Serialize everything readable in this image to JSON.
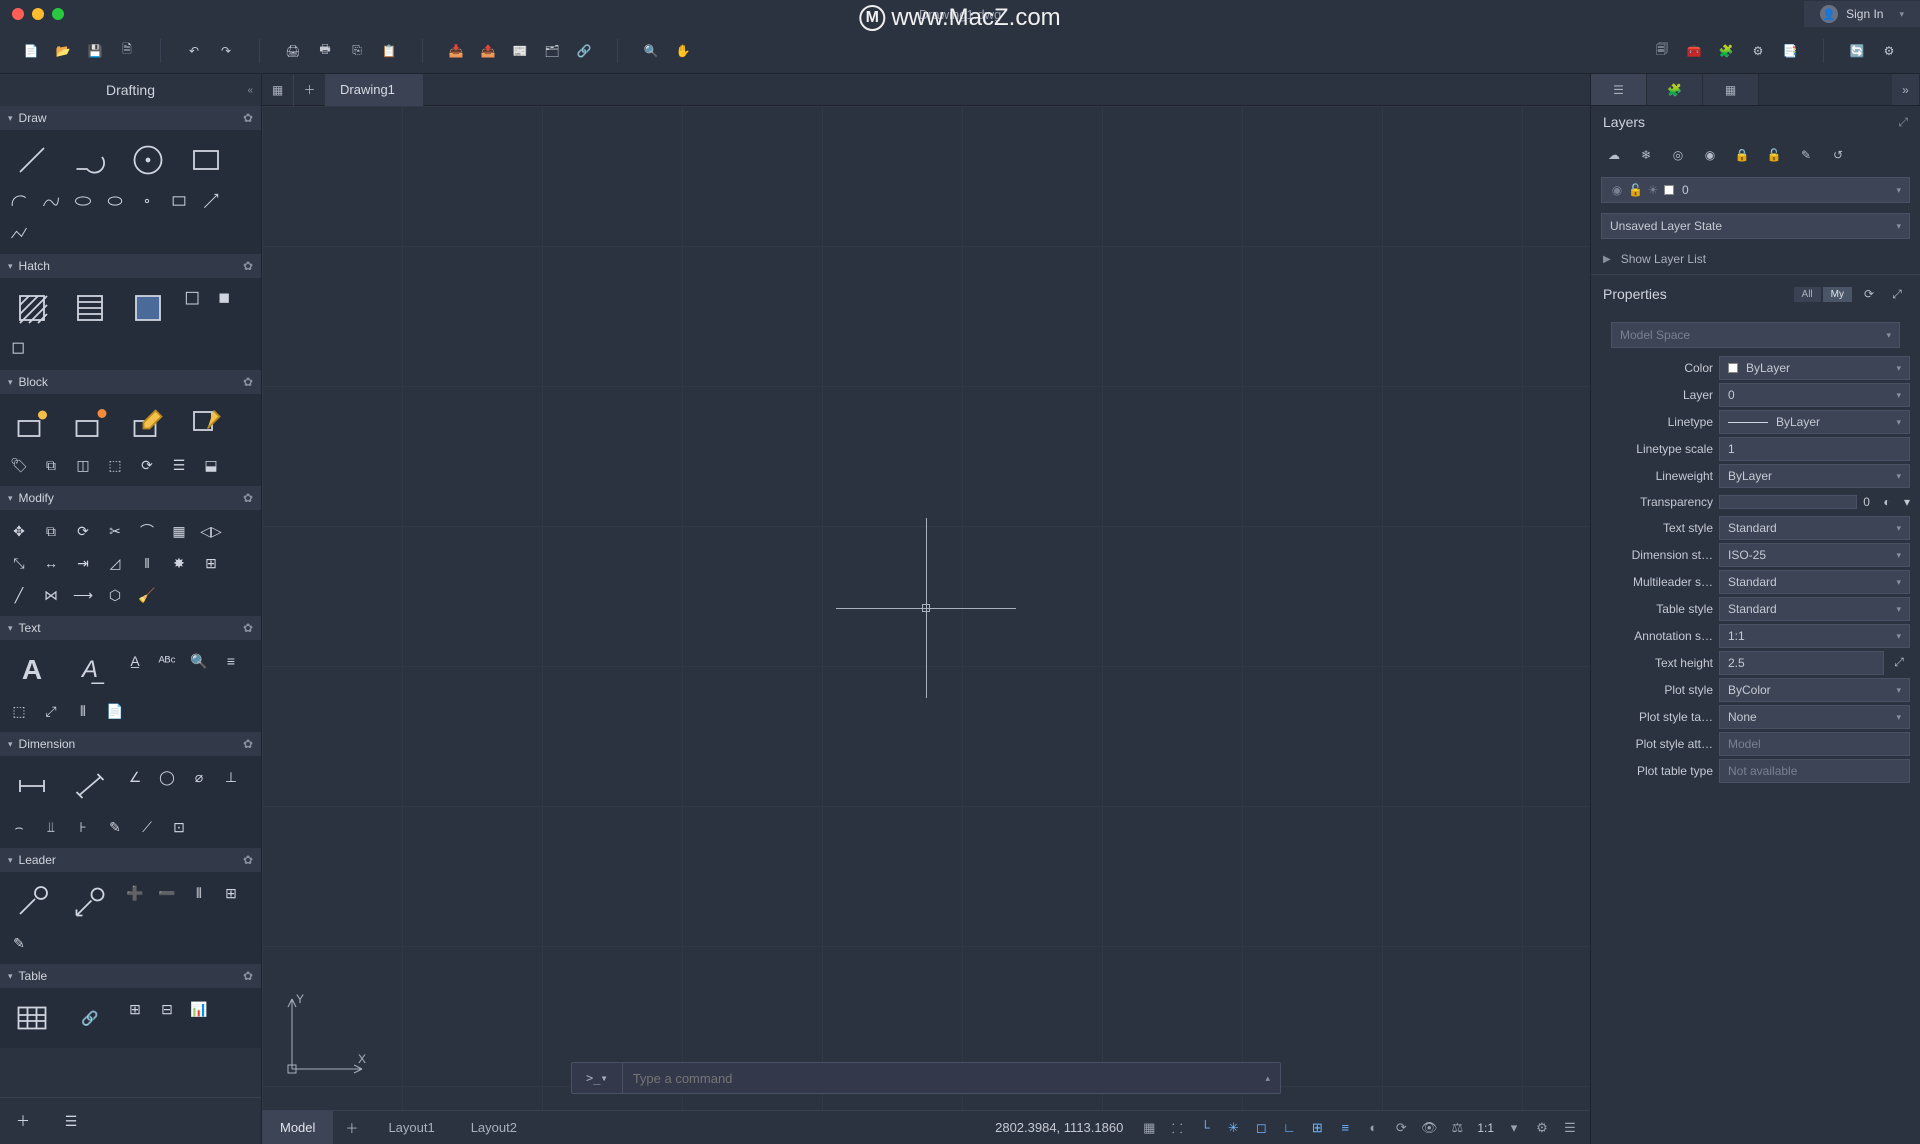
{
  "titlebar": {
    "document_name": "Drawing1.dwg",
    "watermark": "www.MacZ.com",
    "signin": "Sign In"
  },
  "doc_tabs": {
    "active": "Drawing1"
  },
  "left": {
    "title": "Drafting",
    "sections": {
      "draw": "Draw",
      "hatch": "Hatch",
      "block": "Block",
      "modify": "Modify",
      "text": "Text",
      "dimension": "Dimension",
      "leader": "Leader",
      "table": "Table"
    }
  },
  "command": {
    "prompt": ">_▾",
    "placeholder": "Type a command"
  },
  "bottom_tabs": {
    "model": "Model",
    "layout1": "Layout1",
    "layout2": "Layout2"
  },
  "status": {
    "coords": "2802.3984, 1113.1860",
    "scale": "1:1"
  },
  "right": {
    "layers_title": "Layers",
    "current_layer": "0",
    "layer_state": "Unsaved Layer State",
    "show_layer_list": "Show Layer List",
    "properties_title": "Properties",
    "filter_all": "All",
    "filter_my": "My",
    "selection": "Model Space",
    "labels": {
      "color": "Color",
      "layer": "Layer",
      "linetype": "Linetype",
      "linetype_scale": "Linetype scale",
      "lineweight": "Lineweight",
      "transparency": "Transparency",
      "text_style": "Text style",
      "dim_style": "Dimension st…",
      "ml_style": "Multileader s…",
      "table_style": "Table style",
      "anno_scale": "Annotation s…",
      "text_height": "Text height",
      "plot_style": "Plot style",
      "plot_style_table": "Plot style ta…",
      "plot_style_attached": "Plot style att…",
      "plot_table_type": "Plot table type"
    },
    "values": {
      "color": "ByLayer",
      "layer": "0",
      "linetype": "ByLayer",
      "linetype_scale": "1",
      "lineweight": "ByLayer",
      "transparency": "0",
      "text_style": "Standard",
      "dim_style": "ISO-25",
      "ml_style": "Standard",
      "table_style": "Standard",
      "anno_scale": "1:1",
      "text_height": "2.5",
      "plot_style": "ByColor",
      "plot_style_table": "None",
      "plot_style_attached": "Model",
      "plot_table_type": "Not available"
    }
  }
}
